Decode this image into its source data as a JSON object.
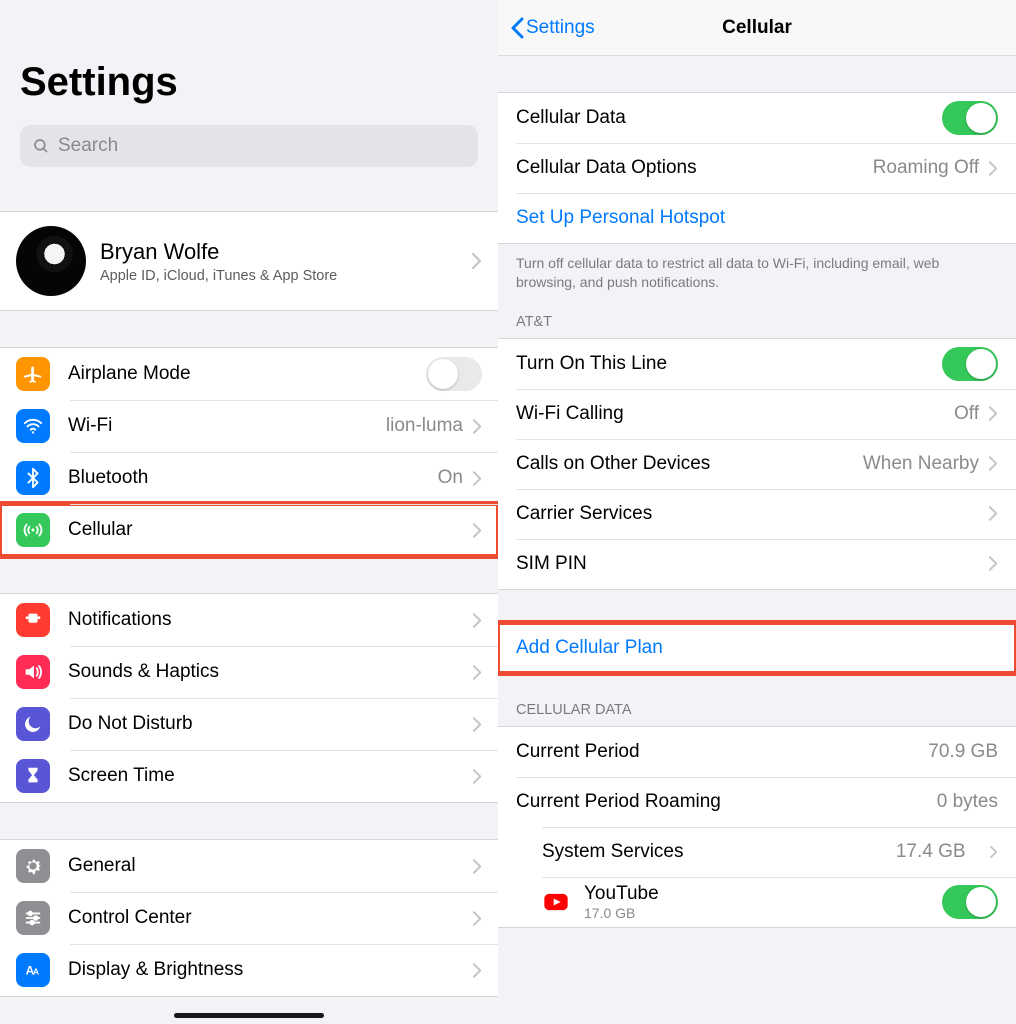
{
  "left": {
    "title": "Settings",
    "search_placeholder": "Search",
    "account": {
      "name": "Bryan Wolfe",
      "desc": "Apple ID, iCloud, iTunes & App Store"
    },
    "group1": [
      {
        "key": "airplane",
        "label": "Airplane Mode",
        "type": "switch",
        "on": false,
        "icon": "airplane",
        "color": "#ff9500"
      },
      {
        "key": "wifi",
        "label": "Wi-Fi",
        "type": "nav",
        "value": "lion-luma",
        "icon": "wifi",
        "color": "#007aff"
      },
      {
        "key": "bluetooth",
        "label": "Bluetooth",
        "type": "nav",
        "value": "On",
        "icon": "bluetooth",
        "color": "#007aff"
      },
      {
        "key": "cellular",
        "label": "Cellular",
        "type": "nav",
        "icon": "cell",
        "color": "#34c759",
        "highlight": true
      }
    ],
    "group2": [
      {
        "key": "notifications",
        "label": "Notifications",
        "type": "nav",
        "icon": "bell",
        "color": "#ff3b30"
      },
      {
        "key": "sounds",
        "label": "Sounds & Haptics",
        "type": "nav",
        "icon": "sound",
        "color": "#ff2d55"
      },
      {
        "key": "dnd",
        "label": "Do Not Disturb",
        "type": "nav",
        "icon": "moon",
        "color": "#5856d6"
      },
      {
        "key": "screentime",
        "label": "Screen Time",
        "type": "nav",
        "icon": "hourglass",
        "color": "#5856d6"
      }
    ],
    "group3": [
      {
        "key": "general",
        "label": "General",
        "type": "nav",
        "icon": "gear",
        "color": "#8e8e93"
      },
      {
        "key": "control",
        "label": "Control Center",
        "type": "nav",
        "icon": "sliders",
        "color": "#8e8e93"
      },
      {
        "key": "display",
        "label": "Display & Brightness",
        "type": "nav",
        "icon": "aa",
        "color": "#007aff"
      }
    ]
  },
  "right": {
    "back_label": "Settings",
    "title": "Cellular",
    "group1": [
      {
        "key": "cell-data",
        "label": "Cellular Data",
        "type": "switch",
        "on": true
      },
      {
        "key": "cell-options",
        "label": "Cellular Data Options",
        "type": "nav",
        "value": "Roaming Off"
      },
      {
        "key": "hotspot",
        "label": "Set Up Personal Hotspot",
        "type": "link"
      }
    ],
    "note1": "Turn off cellular data to restrict all data to Wi-Fi, including email, web browsing, and push notifications.",
    "section_att": "AT&T",
    "group2": [
      {
        "key": "turn-on-line",
        "label": "Turn On This Line",
        "type": "switch",
        "on": true
      },
      {
        "key": "wifi-calling",
        "label": "Wi-Fi Calling",
        "type": "nav",
        "value": "Off"
      },
      {
        "key": "other-calls",
        "label": "Calls on Other Devices",
        "type": "nav",
        "value": "When Nearby"
      },
      {
        "key": "carrier-svc",
        "label": "Carrier Services",
        "type": "nav"
      },
      {
        "key": "sim-pin",
        "label": "SIM PIN",
        "type": "nav"
      }
    ],
    "group3": [
      {
        "key": "add-plan",
        "label": "Add Cellular Plan",
        "type": "link",
        "highlight": true
      }
    ],
    "section_cd": "CELLULAR DATA",
    "group4": [
      {
        "key": "cur-period",
        "label": "Current Period",
        "type": "value",
        "value": "70.9 GB"
      },
      {
        "key": "cur-roaming",
        "label": "Current Period Roaming",
        "type": "value",
        "value": "0 bytes"
      },
      {
        "key": "sys-svc",
        "label": "System Services",
        "type": "nav",
        "value": "17.4 GB",
        "indent": true
      },
      {
        "key": "youtube",
        "label": "YouTube",
        "type": "app-switch",
        "sub": "17.0 GB",
        "on": true,
        "icon": "youtube",
        "indent": true
      }
    ]
  }
}
